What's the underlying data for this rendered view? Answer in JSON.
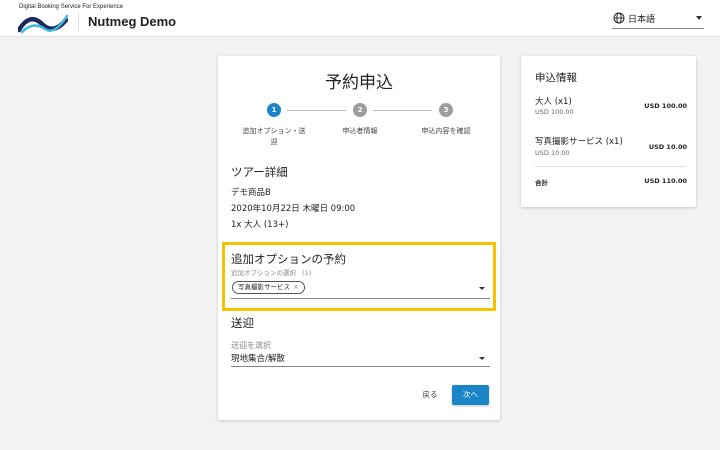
{
  "header": {
    "tagline": "Digital Booking Service For Experience",
    "site_title": "Nutmeg Demo",
    "language": "日本語"
  },
  "page": {
    "title": "予約申込"
  },
  "steps": [
    {
      "number": "1",
      "label": "追加オプション・送迎",
      "active": true
    },
    {
      "number": "2",
      "label": "申込者情報",
      "active": false
    },
    {
      "number": "3",
      "label": "申込内容を確認",
      "active": false
    }
  ],
  "tour": {
    "heading": "ツアー詳細",
    "product": "デモ商品B",
    "datetime": "2020年10月22日 木曜日 09:00",
    "participants": "1x 大人 (13+)"
  },
  "options": {
    "heading": "追加オプションの予約",
    "select_label": "追加オプションの選択",
    "count": "(1)",
    "chip": "写真撮影サービス",
    "chip_close": "×"
  },
  "transfer": {
    "heading": "送迎",
    "select_label": "送迎を選択",
    "value": "現地集合/解散"
  },
  "actions": {
    "back": "戻る",
    "next": "次へ"
  },
  "summary": {
    "title": "申込情報",
    "items": [
      {
        "name": "大人 (x1)",
        "sub": "USD 100.00",
        "price": "USD 100.00"
      },
      {
        "name": "写真撮影サービス (x1)",
        "sub": "USD 10.00",
        "price": "USD 10.00"
      }
    ],
    "total_label": "合計",
    "total_value": "USD 110.00"
  },
  "colors": {
    "accent": "#1a86c8",
    "highlight": "#f5c400",
    "step_inactive": "#9e9e9e"
  }
}
